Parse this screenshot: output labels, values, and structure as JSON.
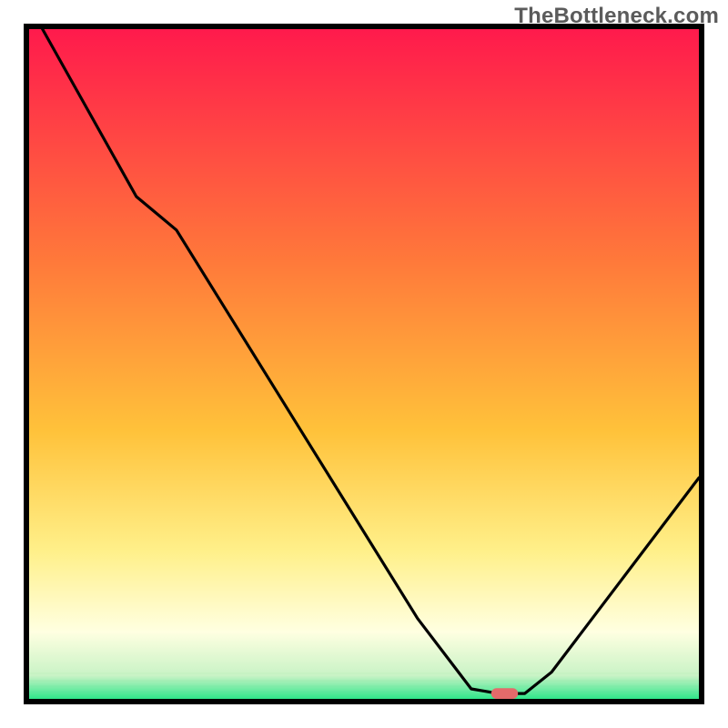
{
  "watermark": {
    "text": "TheBottleneck.com"
  },
  "chart_data": {
    "type": "line",
    "title": "",
    "xlabel": "",
    "ylabel": "",
    "xlim": [
      0,
      100
    ],
    "ylim": [
      0,
      100
    ],
    "grid": false,
    "background": {
      "type": "vertical-gradient",
      "stops": [
        {
          "offset": 0,
          "color": "#ff1a4c"
        },
        {
          "offset": 0.35,
          "color": "#ff7a3a"
        },
        {
          "offset": 0.6,
          "color": "#ffc23a"
        },
        {
          "offset": 0.78,
          "color": "#fff08a"
        },
        {
          "offset": 0.9,
          "color": "#ffffe1"
        },
        {
          "offset": 0.965,
          "color": "#c9f3c6"
        },
        {
          "offset": 1.0,
          "color": "#2fe68a"
        }
      ]
    },
    "series": [
      {
        "name": "bottleneck-curve",
        "color": "#000000",
        "points": [
          {
            "x": 2,
            "y": 100
          },
          {
            "x": 16,
            "y": 75
          },
          {
            "x": 22,
            "y": 70
          },
          {
            "x": 58,
            "y": 12
          },
          {
            "x": 66,
            "y": 1.5
          },
          {
            "x": 70,
            "y": 0.8
          },
          {
            "x": 74,
            "y": 0.8
          },
          {
            "x": 78,
            "y": 4
          },
          {
            "x": 100,
            "y": 33
          }
        ]
      }
    ],
    "marker": {
      "name": "target-point",
      "shape": "capsule",
      "color": "#e46a6a",
      "x": 71,
      "y": 0.8,
      "width": 4,
      "height": 1.6
    },
    "border": {
      "color": "#000000",
      "width": 5
    }
  }
}
